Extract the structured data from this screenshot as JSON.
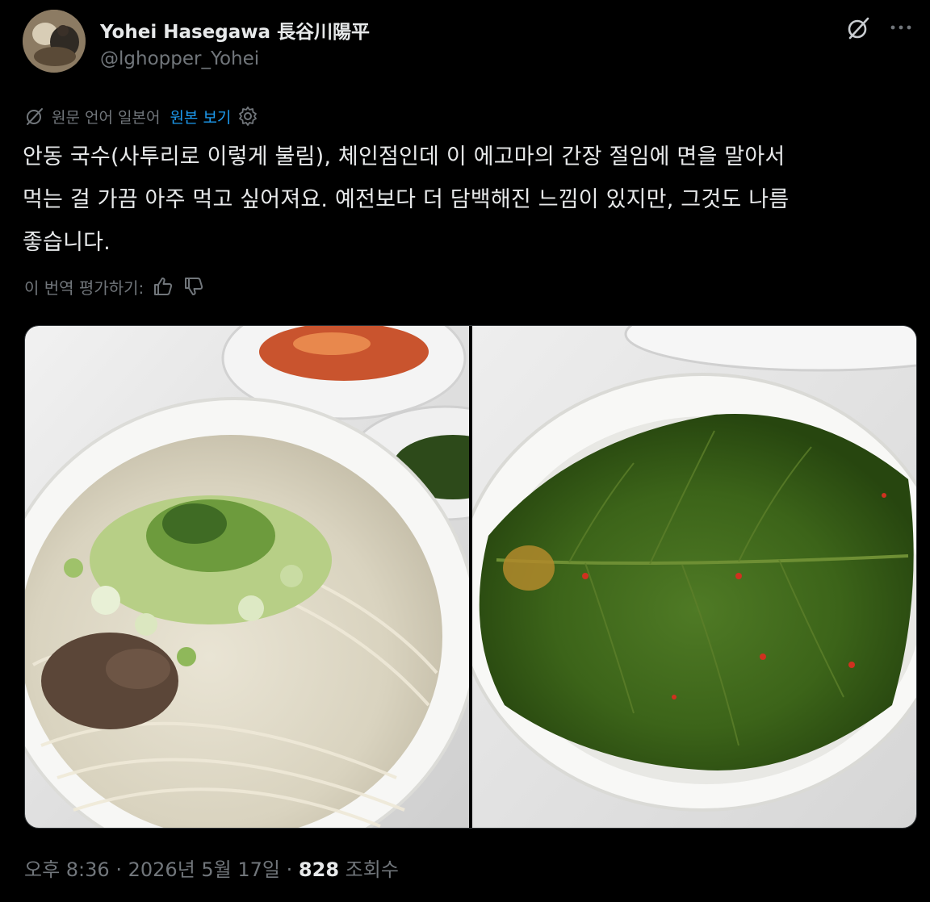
{
  "author": {
    "display_name": "Yohei Hasegawa 長谷川陽平",
    "handle": "@lghopper_Yohei",
    "avatar_icon": "profile-photo"
  },
  "header_actions": {
    "grok_icon": "grok-icon",
    "more_icon": "more-horizontal-icon"
  },
  "translation": {
    "notice": "원문 언어 일본어",
    "show_original": "원본 보기"
  },
  "tweet": {
    "lines": [
      "안동 국수(사투리로 이렇게 불림), 체인점인데 이 에고마의 간장 절임에 면을 말아서",
      "먹는 걸 가끔 아주 먹고 싶어져요. 예전보다 더 담백해진 느낌이 있지만, 그것도 나름",
      "좋습니다."
    ]
  },
  "rating": {
    "label": "이 번역 평가하기:"
  },
  "media": {
    "photos": [
      {
        "subject": "noodle soup with scallions and beef, side dishes of kimchi"
      },
      {
        "subject": "perilla leaves pickled in soy sauce in a white bowl"
      }
    ]
  },
  "meta": {
    "time": "오후 8:36",
    "sep1": "·",
    "date": "2026년 5월 17일",
    "sep2": "·",
    "views_count": "828",
    "views_label": "조회수"
  },
  "colors": {
    "background": "#000000",
    "text_primary": "#e7e9ea",
    "text_secondary": "#71767b",
    "link": "#1d9bf0"
  }
}
